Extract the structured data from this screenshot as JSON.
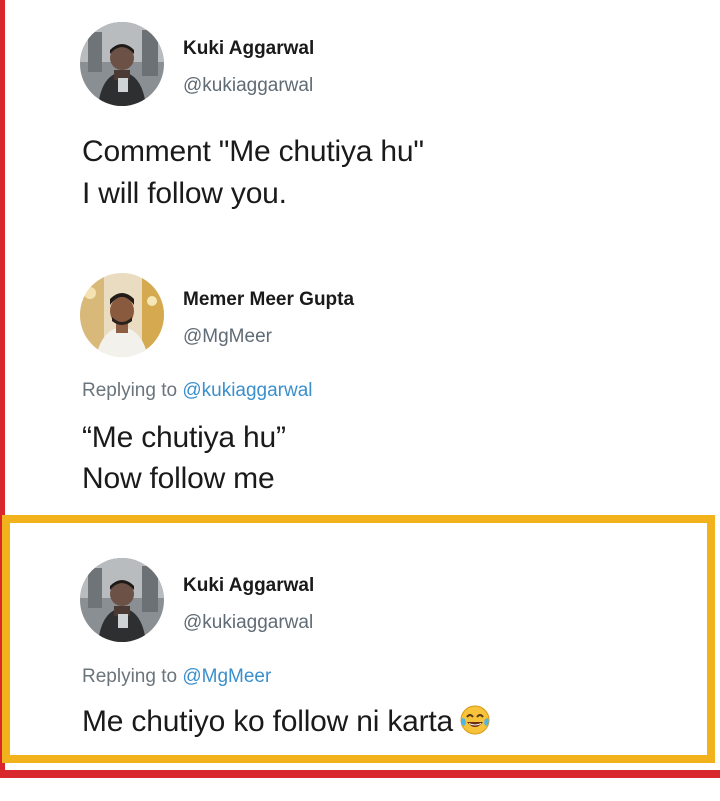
{
  "posts": [
    {
      "name": "Kuki Aggarwal",
      "handle": "@kukiaggarwal",
      "lines": [
        "Comment \"Me chutiya hu\"",
        "I will follow you."
      ]
    },
    {
      "name": "Memer Meer Gupta",
      "handle": "@MgMeer",
      "replying_prefix": "Replying to ",
      "replying_to": "@kukiaggarwal",
      "lines": [
        "“Me chutiya hu”",
        "Now follow me"
      ]
    },
    {
      "name": "Kuki Aggarwal",
      "handle": "@kukiaggarwal",
      "replying_prefix": "Replying to ",
      "replying_to": "@MgMeer",
      "lines": [
        "Me chutiyo ko follow ni karta"
      ],
      "trailing_icon": "tears-of-joy-emoji"
    }
  ],
  "colors": {
    "frame_red": "#d8282d",
    "highlight_yellow": "#f2b21c",
    "mention_blue": "#3a8fcc"
  }
}
